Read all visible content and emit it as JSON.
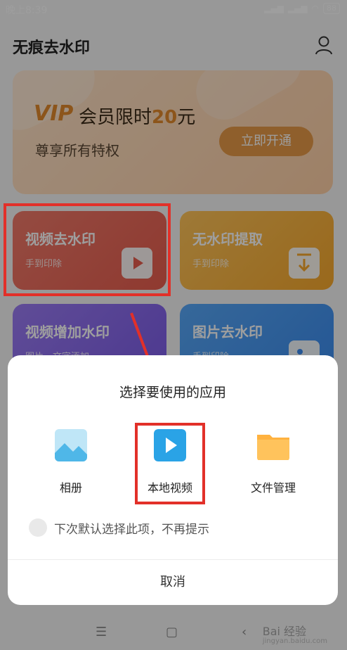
{
  "status_bar": {
    "time": "晚上8:39",
    "battery": "88"
  },
  "header": {
    "title": "无痕去水印"
  },
  "banner": {
    "vip": "VIP",
    "promo_prefix": "会员限时",
    "price": "20",
    "promo_suffix": "元",
    "subtitle": "尊享所有特权",
    "button": "立即开通"
  },
  "features": [
    {
      "title": "视频去水印",
      "subtitle": "手到印除"
    },
    {
      "title": "无水印提取",
      "subtitle": "手到印除"
    },
    {
      "title": "视频增加水印",
      "subtitle": "图片、文字添加"
    },
    {
      "title": "图片去水印",
      "subtitle": "手到印除"
    }
  ],
  "chooser": {
    "title": "选择要使用的应用",
    "options": [
      {
        "label": "相册",
        "icon": "gallery-icon"
      },
      {
        "label": "本地视频",
        "icon": "video-play-icon"
      },
      {
        "label": "文件管理",
        "icon": "folder-icon"
      }
    ],
    "remember_text": "下次默认选择此项，不再提示",
    "cancel": "取消"
  },
  "watermark": {
    "brand": "Bai 经验",
    "url": "jingyan.baidu.com"
  },
  "colors": {
    "highlight": "#e23029",
    "accent": "#e79a48"
  }
}
